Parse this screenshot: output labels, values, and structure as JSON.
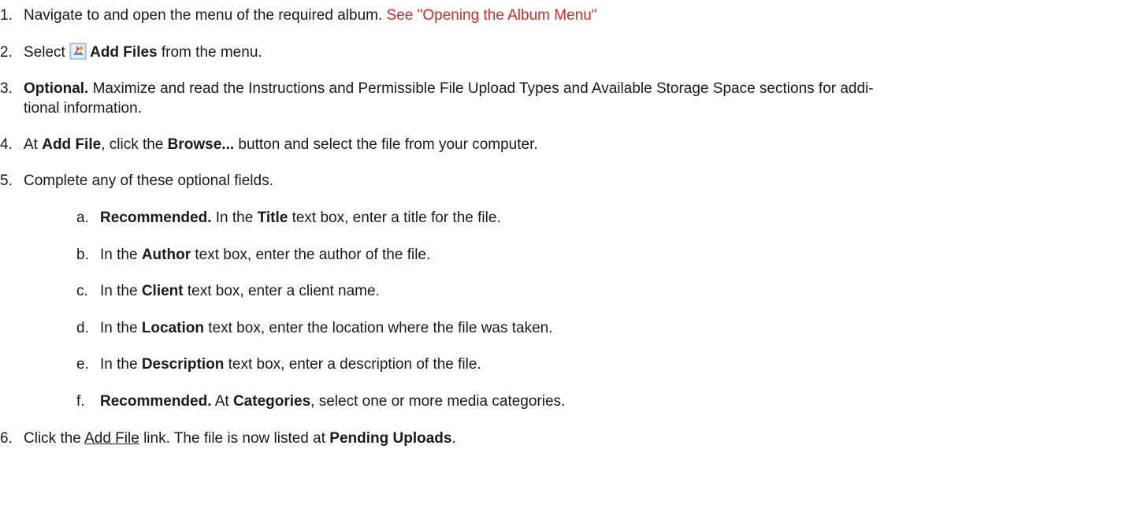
{
  "steps": {
    "s1": {
      "num": "1.",
      "text": "Navigate to and open the menu of the required album. ",
      "link": "See \"Opening the Album Menu\""
    },
    "s2": {
      "num": "2.",
      "pre": "Select ",
      "bold": "Add Files",
      "post": " from the menu."
    },
    "s3": {
      "num": "3.",
      "bold": "Optional.",
      "line1": " Maximize and read the Instructions and Permissible File Upload Types and Available Storage Space sections for addi-",
      "line2": "tional information."
    },
    "s4": {
      "num": "4.",
      "pre": "At ",
      "bold1": "Add File",
      "mid": ", click the ",
      "bold2": "Browse...",
      "post": " button and select the file from your computer."
    },
    "s5": {
      "num": "5.",
      "text": "Complete any of these optional fields."
    },
    "s6": {
      "num": "6.",
      "pre": "Click the ",
      "link": "Add File",
      "mid": " link. The file is now listed at ",
      "bold": "Pending Uploads",
      "post": "."
    }
  },
  "substeps": {
    "a": {
      "letter": "a.",
      "bold1": "Recommended.",
      "pre": " In the ",
      "bold2": "Title",
      "post": " text box, enter a title for the file."
    },
    "b": {
      "letter": "b.",
      "pre": "In the ",
      "bold": "Author",
      "post": " text box, enter the author of the file."
    },
    "c": {
      "letter": "c.",
      "pre": "In the ",
      "bold": "Client",
      "post": " text box, enter a client name."
    },
    "d": {
      "letter": "d.",
      "pre": "In the ",
      "bold": "Location",
      "post": " text box, enter the location where the file was taken."
    },
    "e": {
      "letter": "e.",
      "pre": "In the ",
      "bold": "Description",
      "post": " text box, enter a description of the file."
    },
    "f": {
      "letter": "f.",
      "bold1": "Recommended.",
      "pre": " At ",
      "bold2": "Categories",
      "post": ", select one or more media categories."
    }
  },
  "icons": {
    "add_files": "add-files-icon"
  },
  "colors": {
    "link": "#d2282a"
  }
}
